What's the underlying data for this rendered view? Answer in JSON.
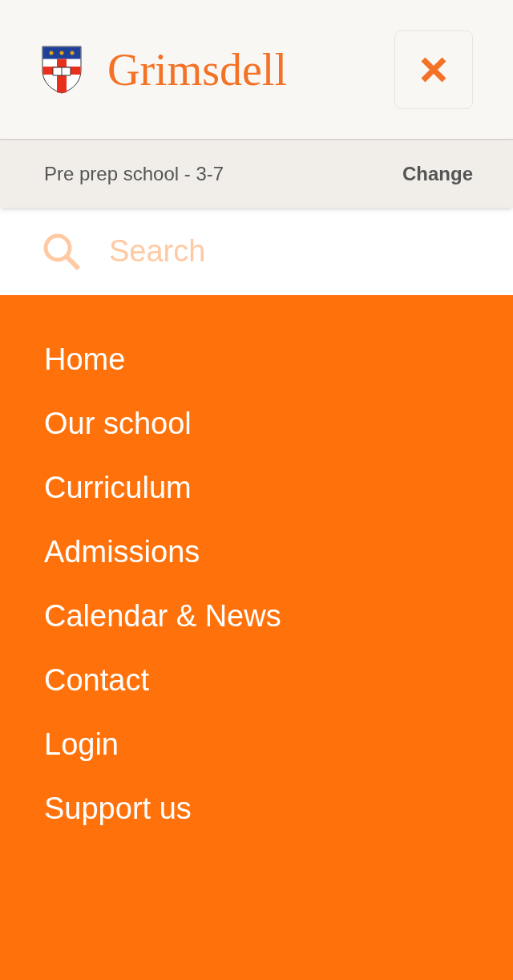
{
  "header": {
    "brand": "Grimsdell"
  },
  "school_bar": {
    "label": "Pre prep school - 3-7",
    "action": "Change"
  },
  "search": {
    "placeholder": "Search"
  },
  "menu": [
    {
      "label": "Home"
    },
    {
      "label": "Our school"
    },
    {
      "label": "Curriculum"
    },
    {
      "label": "Admissions"
    },
    {
      "label": "Calendar & News"
    },
    {
      "label": "Contact"
    },
    {
      "label": "Login"
    },
    {
      "label": "Support us"
    }
  ]
}
